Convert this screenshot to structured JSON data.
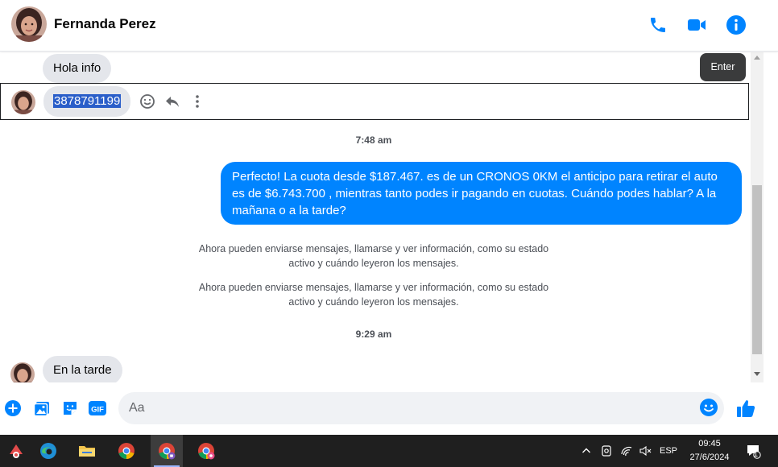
{
  "contact": {
    "name": "Fernanda Perez"
  },
  "header_icons": [
    "phone-icon",
    "video-call-icon",
    "info-icon"
  ],
  "messages": {
    "incoming_1": "Hola info",
    "incoming_2": "3878791199",
    "time_1": "7:48 am",
    "outgoing_1": "Perfecto! La cuota desde $187.467. es de un CRONOS 0KM el anticipo para retirar el auto es de $6.743.700 , mientras tanto podes ir pagando en cuotas. Cuándo podes hablar? A la mañana o a la tarde?",
    "system_1_line1": "Ahora pueden enviarse mensajes, llamarse y ver información, como su estado",
    "system_1_line2": "activo y cuándo leyeron los mensajes.",
    "system_2_line1": "Ahora pueden enviarse mensajes, llamarse y ver información, como su estado",
    "system_2_line2": "activo y cuándo leyeron los mensajes.",
    "time_2": "9:29 am",
    "incoming_3": "En la tarde"
  },
  "tooltip": {
    "label": "Enter"
  },
  "composer": {
    "placeholder": "Aa",
    "value": ""
  },
  "taskbar": {
    "language": "ESP",
    "time": "09:45",
    "date": "27/6/2024",
    "notification_count": "1"
  },
  "colors": {
    "accent": "#0084ff",
    "incoming_bubble": "#e4e6eb",
    "taskbar": "#1f1f1f"
  }
}
